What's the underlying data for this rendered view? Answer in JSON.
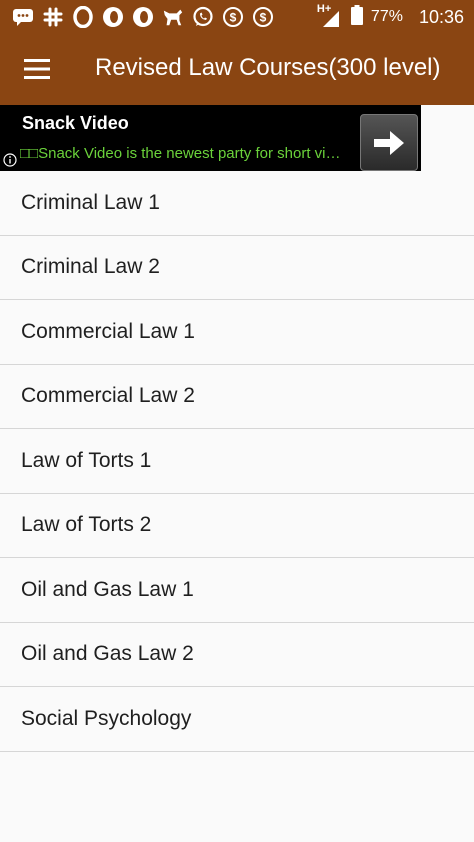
{
  "status_bar": {
    "icons": [
      "message-icon",
      "slack-icon",
      "opera-icon",
      "opera-mini-icon",
      "opera-mini-icon",
      "bull-icon",
      "whatsapp-icon",
      "dollar-icon",
      "dollar-icon"
    ],
    "network": "H+",
    "battery_percent": "77%",
    "time": "10:36"
  },
  "app_bar": {
    "title": "Revised Law Courses(300 level)",
    "color": "#8a4512"
  },
  "ad": {
    "title": "Snack Video",
    "description": "□□Snack Video is the newest party for short videos",
    "desc_color": "#6bd23b"
  },
  "courses": [
    {
      "label": "Criminal Law 1"
    },
    {
      "label": "Criminal Law 2"
    },
    {
      "label": "Commercial Law 1"
    },
    {
      "label": "Commercial Law 2"
    },
    {
      "label": "Law of Torts 1"
    },
    {
      "label": "Law of Torts 2"
    },
    {
      "label": "Oil and Gas Law 1"
    },
    {
      "label": "Oil and Gas Law 2"
    },
    {
      "label": "Social Psychology"
    }
  ]
}
